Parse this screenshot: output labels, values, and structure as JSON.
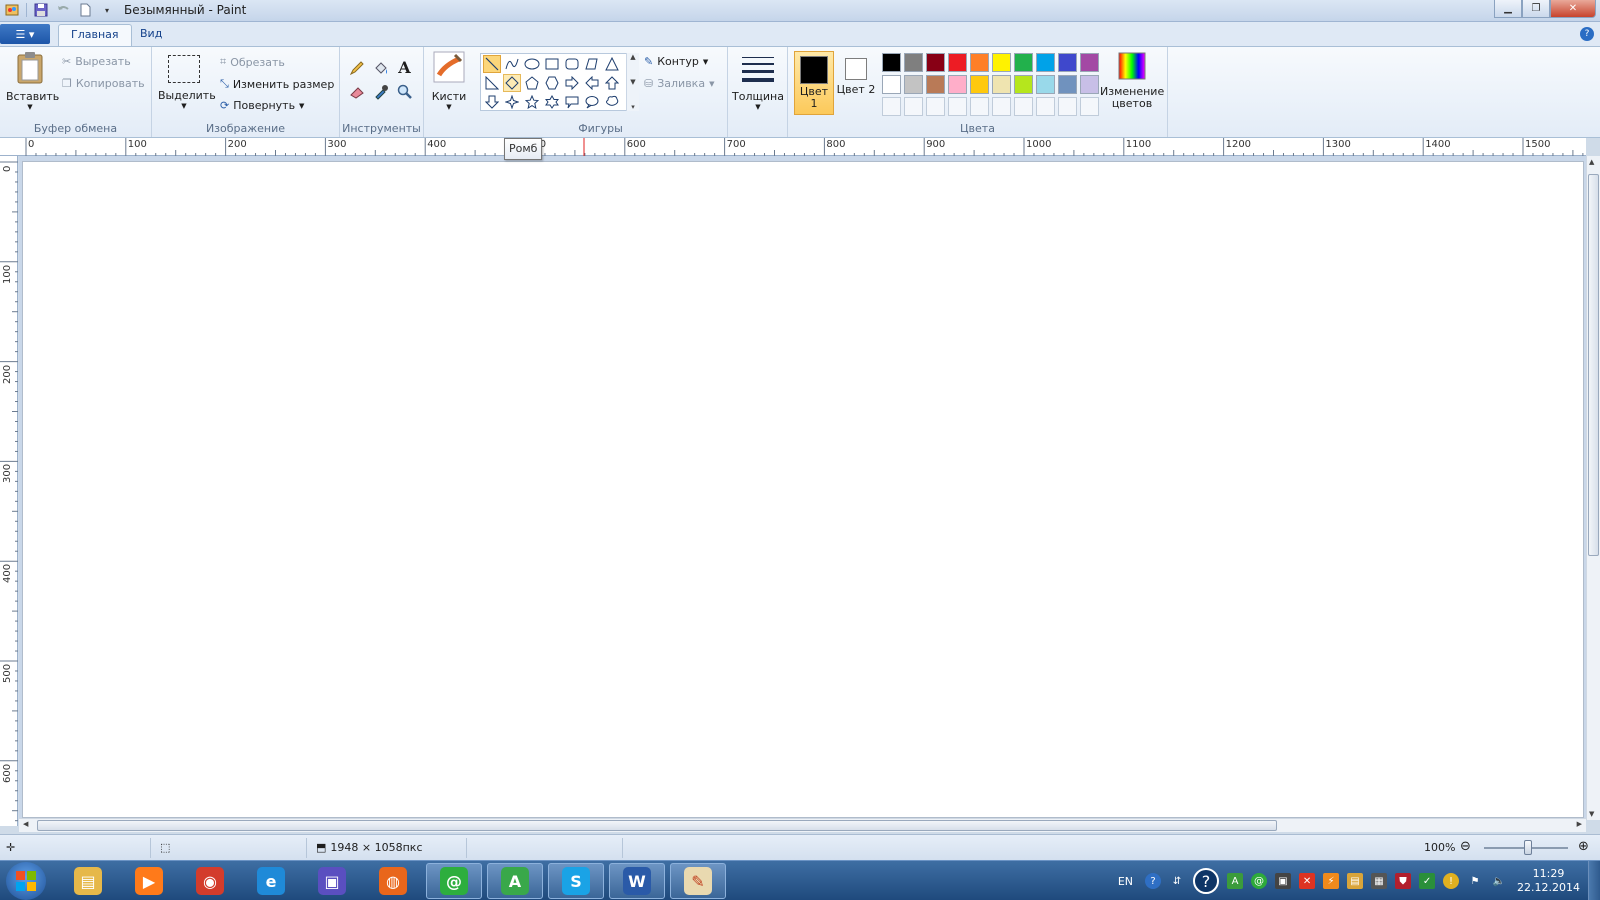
{
  "window": {
    "title": "Безымянный - Paint"
  },
  "tabs": {
    "home": "Главная",
    "view": "Вид"
  },
  "clipboard": {
    "paste": "Вставить",
    "cut": "Вырезать",
    "copy": "Копировать",
    "group": "Буфер обмена"
  },
  "image": {
    "select": "Выделить",
    "crop": "Обрезать",
    "resize": "Изменить размер",
    "rotate": "Повернуть",
    "group": "Изображение"
  },
  "tools": {
    "group": "Инструменты"
  },
  "brushes": {
    "label": "Кисти"
  },
  "shapes": {
    "group": "Фигуры",
    "outline": "Контур",
    "fill": "Заливка",
    "tooltip": "Ромб",
    "selected": "line",
    "hovered": "diamond"
  },
  "size": {
    "label": "Толщина"
  },
  "colors": {
    "group": "Цвета",
    "color1_label": "Цвет 1",
    "color2_label": "Цвет 2",
    "color1": "#000000",
    "color2": "#ffffff",
    "edit": "Изменение цветов",
    "palette_row1": [
      "#000000",
      "#7f7f7f",
      "#880015",
      "#ed1c24",
      "#ff7f27",
      "#fff200",
      "#22b14c",
      "#00a2e8",
      "#3f48cc",
      "#a349a4"
    ],
    "palette_row2": [
      "#ffffff",
      "#c3c3c3",
      "#b97a57",
      "#ffaec9",
      "#ffc90e",
      "#efe4b0",
      "#b5e61d",
      "#99d9ea",
      "#7092be",
      "#c8bfe7"
    ]
  },
  "ruler": {
    "h_labels": [
      "0",
      "100",
      "200",
      "300",
      "400",
      "500",
      "600",
      "700",
      "800",
      "900",
      "1000",
      "1100",
      "1200",
      "1300",
      "1400",
      "1500"
    ],
    "v_labels": [
      "0",
      "100",
      "200",
      "300",
      "400",
      "500",
      "600"
    ]
  },
  "status": {
    "dimensions": "1948 × 1058пкс",
    "zoom": "100%"
  },
  "taskbar": {
    "apps": [
      "explorer-icon",
      "media-player-icon",
      "chrome-icon",
      "internet-explorer-icon",
      "save-disk-icon",
      "firefox-icon",
      "mail-agent-icon",
      "abbyy-icon",
      "skype-icon",
      "word-icon",
      "paint-icon"
    ],
    "language": "EN",
    "time": "11:29",
    "date": "22.12.2014"
  }
}
